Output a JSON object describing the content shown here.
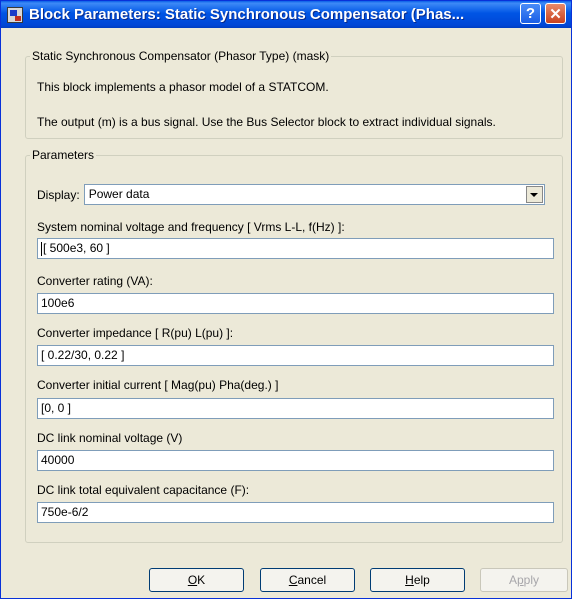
{
  "window": {
    "title": "Block Parameters: Static Synchronous Compensator (Phas...",
    "help_glyph": "?",
    "close_glyph": "✕"
  },
  "mask": {
    "legend": "Static Synchronous Compensator (Phasor Type) (mask)",
    "line1": "This block implements a phasor model of a STATCOM.",
    "line2": "The output (m) is a bus signal. Use the Bus Selector block to extract individual signals."
  },
  "params": {
    "legend": "Parameters",
    "display_label": "Display:",
    "display_value": "Power data",
    "fields": [
      {
        "label": "System nominal voltage and frequency [ Vrms L-L, f(Hz) ]:",
        "value": "[ 500e3, 60 ]"
      },
      {
        "label": "Converter rating (VA):",
        "value": "100e6"
      },
      {
        "label": "Converter impedance [ R(pu)  L(pu) ]:",
        "value": "[ 0.22/30, 0.22 ]"
      },
      {
        "label": "Converter initial current [ Mag(pu)  Pha(deg.) ]",
        "value": "[0, 0 ]"
      },
      {
        "label": "DC link nominal voltage (V)",
        "value": "40000"
      },
      {
        "label": "DC link total equivalent capacitance (F):",
        "value": "750e-6/2"
      }
    ]
  },
  "buttons": {
    "ok_key": "O",
    "ok_rest": "K",
    "cancel_key": "C",
    "cancel_rest": "ancel",
    "help_key": "H",
    "help_rest": "elp",
    "apply_pre": "A",
    "apply_key": "p",
    "apply_rest": "ply"
  },
  "colors": {
    "titlebar": "#0055e5",
    "dialog_bg": "#ece9d8",
    "close_button": "#c9421f"
  }
}
